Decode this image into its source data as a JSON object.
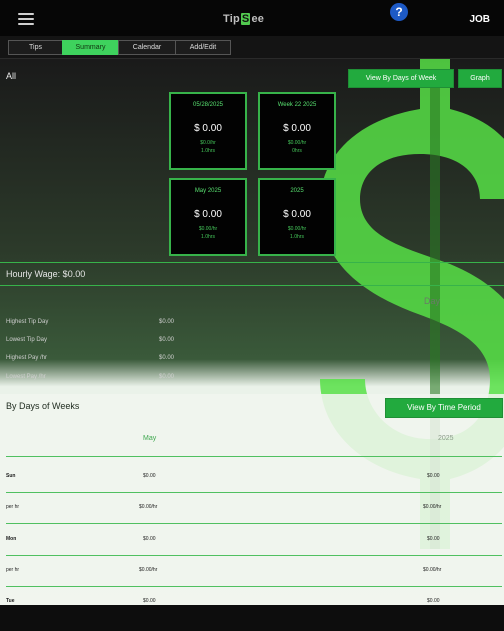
{
  "topbar": {
    "logo_pre": "Tip",
    "logo_mid": "S",
    "logo_post": "ee",
    "help_symbol": "?",
    "job_label": "JOB"
  },
  "tabs": [
    {
      "label": "Tips",
      "active": false
    },
    {
      "label": "Summary",
      "active": true
    },
    {
      "label": "Calendar",
      "active": false
    },
    {
      "label": "Add/Edit",
      "active": false
    }
  ],
  "summary": {
    "all_label": "All",
    "view_by_days_button": "View By Days of Week",
    "graph_button": "Graph",
    "cards": [
      {
        "title": "05/28/2025",
        "amount": "$ 0.00",
        "rate": "$0.0/hr",
        "hours": "1.0hrs"
      },
      {
        "title": "Week 22 2025",
        "amount": "$ 0.00",
        "rate": "$0.00/hr",
        "hours": "0hrs"
      },
      {
        "title": "May 2025",
        "amount": "$ 0.00",
        "rate": "$0.00/hr",
        "hours": "1.0hrs"
      },
      {
        "title": "2025",
        "amount": "$ 0.00",
        "rate": "$0.00/hr",
        "hours": "1.0hrs"
      }
    ],
    "hourly_wage": "Hourly Wage: $0.00",
    "day_header": "Day",
    "stats": [
      {
        "label": "Highest Tip Day",
        "value": "$0.00"
      },
      {
        "label": "Lowest Tip Day",
        "value": "$0.00"
      },
      {
        "label": "Highest Pay /hr",
        "value": "$0.00"
      },
      {
        "label": "Lowest Pay /hr",
        "value": "$0.00"
      }
    ]
  },
  "by_days": {
    "title": "By Days of Weeks",
    "view_by_time_button": "View By Time Period",
    "col_month": "May",
    "col_year": "2025",
    "rows": [
      {
        "label": "Sun",
        "bold": true,
        "month": "$0.00",
        "year": "$0.00"
      },
      {
        "label": "per hr",
        "bold": false,
        "month": "$0.00/hr",
        "year": "$0.00/hr"
      },
      {
        "label": "Mon",
        "bold": true,
        "month": "$0.00",
        "year": "$0.00"
      },
      {
        "label": "per hr",
        "bold": false,
        "month": "$0.00/hr",
        "year": "$0.00/hr"
      },
      {
        "label": "Tue",
        "bold": true,
        "month": "$0.00",
        "year": "$0.00"
      }
    ]
  },
  "colors": {
    "accent": "#37b34a",
    "button_green": "#22aa3e",
    "help_blue": "#1d5ac6"
  }
}
